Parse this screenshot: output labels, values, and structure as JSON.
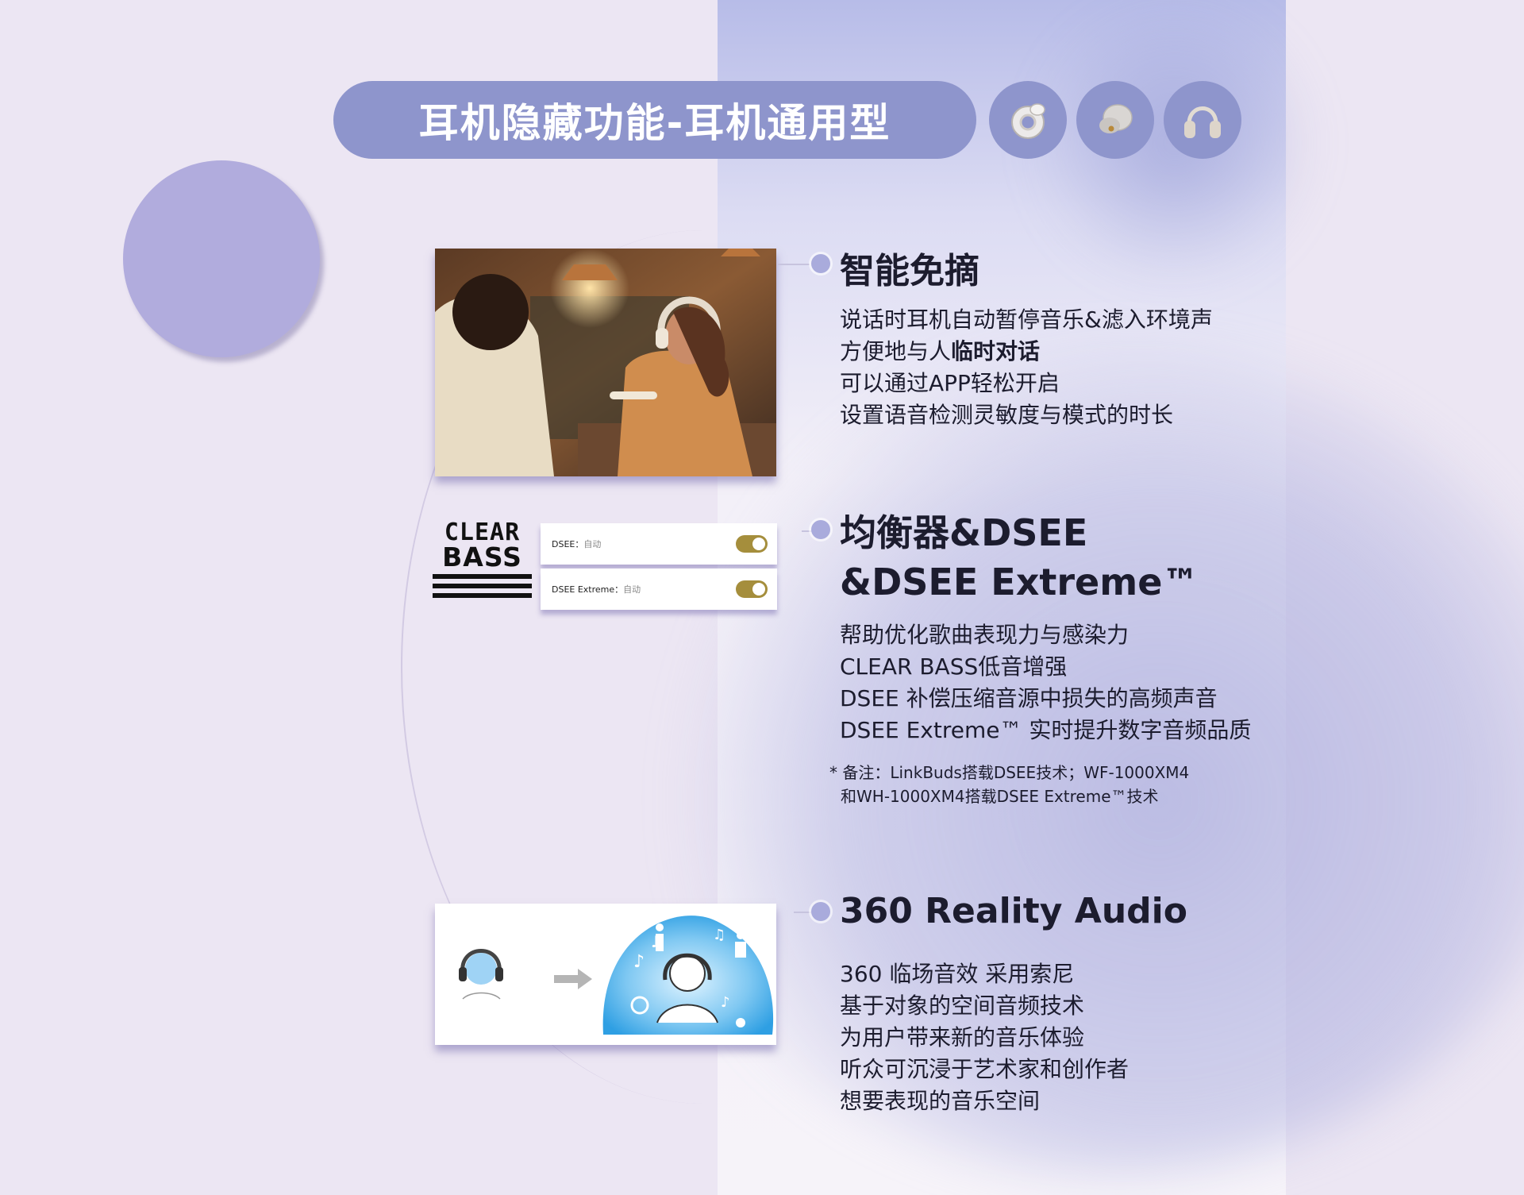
{
  "title": "耳机隐藏功能-耳机通用型",
  "product_icons": [
    {
      "name": "linkbuds-earbud-icon"
    },
    {
      "name": "wf-1000xm4-earbud-icon"
    },
    {
      "name": "wh-1000xm4-headphone-icon"
    }
  ],
  "sections": [
    {
      "heading": "智能免摘",
      "lines": [
        "说话时耳机自动暂停音乐&滤入环境声",
        "方便地与人",
        "临时对话",
        "可以通过APP轻松开启",
        "设置语音检测灵敏度与模式的时长"
      ]
    },
    {
      "heading_line1": "均衡器&DSEE",
      "heading_line2": "&DSEE Extreme™",
      "lines": [
        "帮助优化歌曲表现力与感染力",
        "CLEAR BASS低音增强",
        "DSEE 补偿压缩音源中损失的高频声音",
        "DSEE Extreme™ 实时提升数字音频品质"
      ],
      "note_line1": "* 备注：LinkBuds搭载DSEE技术；WF-1000XM4",
      "note_line2": "和WH-1000XM4搭载DSEE Extreme™技术"
    },
    {
      "heading": "360 Reality Audio",
      "lines": [
        "360 临场音效 采用索尼",
        "基于对象的空间音频技术",
        "为用户带来新的音乐体验",
        "听众可沉浸于艺术家和创作者",
        "想要表现的音乐空间"
      ]
    }
  ],
  "clear_bass": {
    "line1": "CLEAR",
    "line2": "BASS"
  },
  "toggles": [
    {
      "label": "DSEE：",
      "value": "自动",
      "on": true
    },
    {
      "label": "DSEE Extreme：",
      "value": "自动",
      "on": true
    }
  ],
  "colors": {
    "accent": "#8e95cc",
    "background": "#ece6f3",
    "toggle_on": "#a58e3c"
  }
}
